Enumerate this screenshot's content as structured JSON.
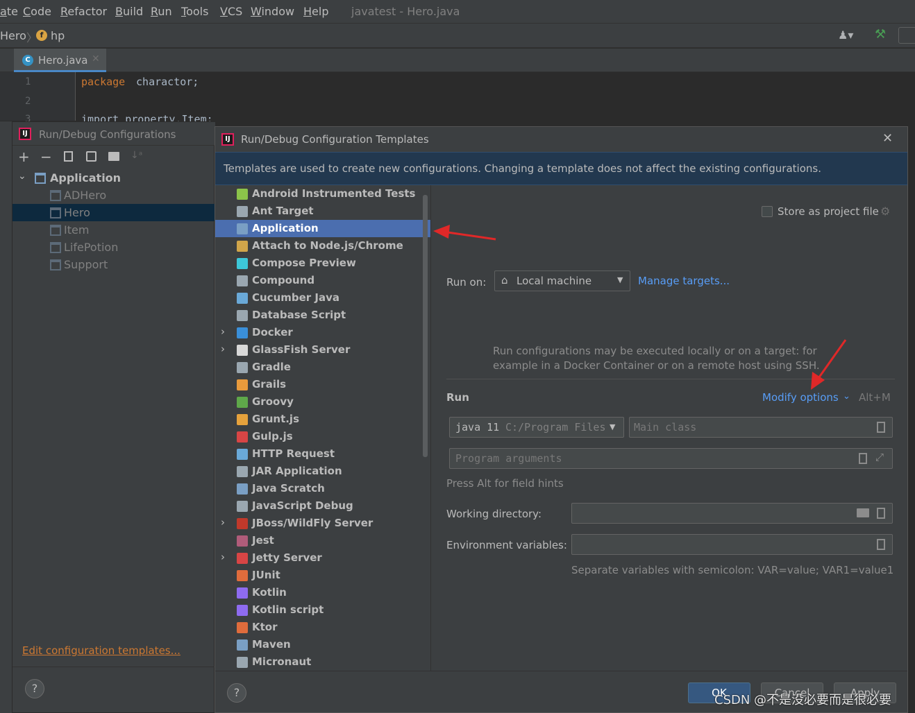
{
  "menubar": {
    "items": [
      "ate",
      "Code",
      "Refactor",
      "Build",
      "Run",
      "Tools",
      "VCS",
      "Window",
      "Help"
    ],
    "window_title": "javatest - Hero.java"
  },
  "navbar": {
    "crumb1": "Hero",
    "crumb2": "hp"
  },
  "editor_tab": {
    "label": "Hero.java"
  },
  "editor": {
    "line1_num": "1",
    "line2_num": "2",
    "line3_num": "3",
    "line1_kw": "package",
    "line1_rest": " charactor;",
    "line3_text": "import property.Item;"
  },
  "left_dialog": {
    "title": "Run/Debug Configurations",
    "root_label": "Application",
    "children": [
      "ADHero",
      "Hero",
      "Item",
      "LifePotion",
      "Support"
    ],
    "edit_link": "Edit configuration templates...",
    "help": "?"
  },
  "dialog": {
    "title": "Run/Debug Configuration Templates",
    "banner": "Templates are used to create new configurations. Changing a template does not affect the existing configurations.",
    "help": "?",
    "store_label": "Store as project file",
    "run_on_label": "Run on:",
    "run_on_value": "Local machine",
    "manage_targets": "Manage targets...",
    "hint_line1": "Run configurations may be executed locally or on a target: for",
    "hint_line2": "example in a Docker Container or on a remote host using SSH.",
    "run_section": "Run",
    "modify_options": "Modify options",
    "modify_shortcut": "Alt+M",
    "jdk_version": "java 11",
    "jdk_path": "C:/Program Files",
    "main_class_placeholder": "Main class",
    "program_args_placeholder": "Program arguments",
    "press_alt": "Press Alt for field hints",
    "working_dir_label": "Working directory:",
    "env_vars_label": "Environment variables:",
    "env_hint": "Separate variables with semicolon: VAR=value; VAR1=value1",
    "ok": "OK",
    "cancel": "Cancel",
    "apply": "Apply"
  },
  "templates": [
    {
      "label": "Android Instrumented Tests",
      "icon_color": "#8bc34a",
      "expandable": false
    },
    {
      "label": "Ant Target",
      "icon_color": "#9aa7b0",
      "expandable": false
    },
    {
      "label": "Application",
      "icon_color": "#7a9fc4",
      "expandable": false
    },
    {
      "label": "Attach to Node.js/Chrome",
      "icon_color": "#d0a54a",
      "expandable": false
    },
    {
      "label": "Compose Preview",
      "icon_color": "#3dc7d8",
      "expandable": false
    },
    {
      "label": "Compound",
      "icon_color": "#9aa7b0",
      "expandable": false
    },
    {
      "label": "Cucumber Java",
      "icon_color": "#6aa9d8",
      "expandable": false
    },
    {
      "label": "Database Script",
      "icon_color": "#9aa7b0",
      "expandable": false
    },
    {
      "label": "Docker",
      "icon_color": "#3a8fd9",
      "expandable": true
    },
    {
      "label": "GlassFish Server",
      "icon_color": "#d8d8d8",
      "expandable": true
    },
    {
      "label": "Gradle",
      "icon_color": "#9aa7b0",
      "expandable": false
    },
    {
      "label": "Grails",
      "icon_color": "#e89a3c",
      "expandable": false
    },
    {
      "label": "Groovy",
      "icon_color": "#5fa84a",
      "expandable": false
    },
    {
      "label": "Grunt.js",
      "icon_color": "#e6a23c",
      "expandable": false
    },
    {
      "label": "Gulp.js",
      "icon_color": "#d84545",
      "expandable": false
    },
    {
      "label": "HTTP Request",
      "icon_color": "#6aa9d8",
      "expandable": false
    },
    {
      "label": "JAR Application",
      "icon_color": "#9aa7b0",
      "expandable": false
    },
    {
      "label": "Java Scratch",
      "icon_color": "#7a9fc4",
      "expandable": false
    },
    {
      "label": "JavaScript Debug",
      "icon_color": "#9aa7b0",
      "expandable": false
    },
    {
      "label": "JBoss/WildFly Server",
      "icon_color": "#c0392b",
      "expandable": true
    },
    {
      "label": "Jest",
      "icon_color": "#b05c7a",
      "expandable": false
    },
    {
      "label": "Jetty Server",
      "icon_color": "#d84545",
      "expandable": true
    },
    {
      "label": "JUnit",
      "icon_color": "#e06c3c",
      "expandable": false
    },
    {
      "label": "Kotlin",
      "icon_color": "#8e6bf0",
      "expandable": false
    },
    {
      "label": "Kotlin script",
      "icon_color": "#8e6bf0",
      "expandable": false
    },
    {
      "label": "Ktor",
      "icon_color": "#e06c3c",
      "expandable": false
    },
    {
      "label": "Maven",
      "icon_color": "#7a9fc4",
      "expandable": false
    },
    {
      "label": "Micronaut",
      "icon_color": "#9aa7b0",
      "expandable": false
    }
  ],
  "selected_template": "Application",
  "watermark": "CSDN @不是没必要而是很必要",
  "colors": {
    "selection": "#4b6eaf",
    "link": "#589df6",
    "banner": "#22384f",
    "ok_button": "#365880",
    "edit_link": "#cc7832"
  }
}
